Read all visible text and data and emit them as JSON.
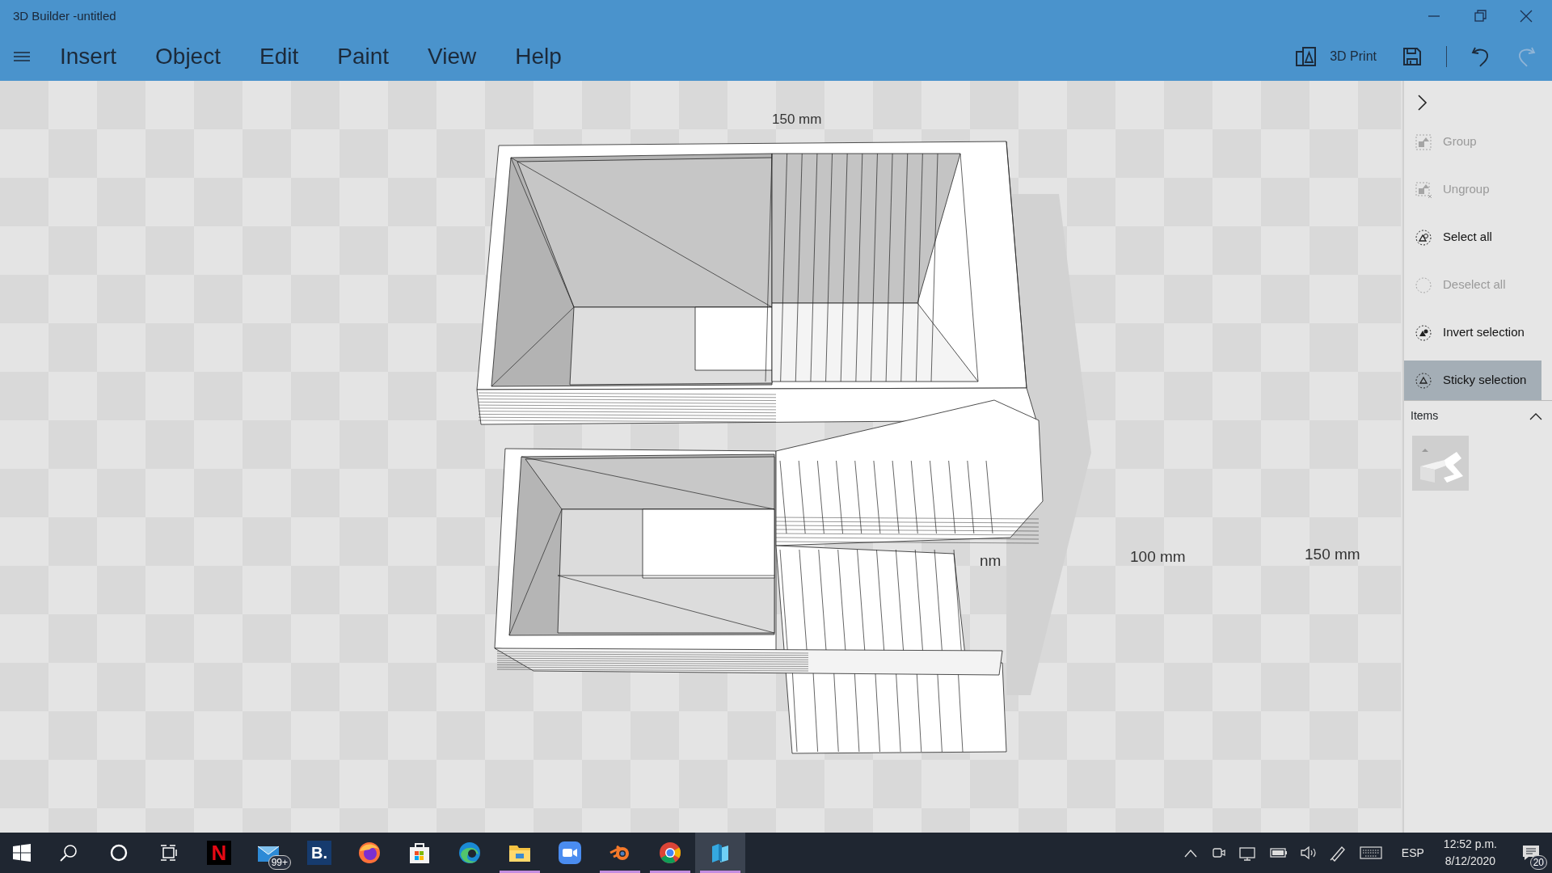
{
  "window": {
    "title": "3D Builder -untitled"
  },
  "menu": [
    {
      "label": "Insert"
    },
    {
      "label": "Object"
    },
    {
      "label": "Edit"
    },
    {
      "label": "Paint"
    },
    {
      "label": "View"
    },
    {
      "label": "Help"
    }
  ],
  "toolbar": {
    "print_label": "3D Print",
    "undo_disabled": false,
    "redo_disabled": true
  },
  "viewport": {
    "rulers": [
      {
        "text": "150 mm"
      },
      {
        "text": "nm"
      },
      {
        "text": "100 mm"
      },
      {
        "text": "150 mm"
      }
    ]
  },
  "panel": {
    "actions": [
      {
        "kind": "group",
        "label": "Group",
        "disabled": true,
        "selected": false
      },
      {
        "kind": "ungroup",
        "label": "Ungroup",
        "disabled": true,
        "selected": false
      },
      {
        "kind": "select",
        "label": "Select all",
        "disabled": false,
        "selected": false
      },
      {
        "kind": "deselect",
        "label": "Deselect all",
        "disabled": true,
        "selected": false
      },
      {
        "kind": "invert",
        "label": "Invert selection",
        "disabled": false,
        "selected": false
      },
      {
        "kind": "sticky",
        "label": "Sticky selection",
        "disabled": false,
        "selected": true
      }
    ],
    "items_header": "Items",
    "items_expanded": true
  },
  "taskbar": {
    "apps": [
      {
        "kind": "start",
        "running": false,
        "active": false
      },
      {
        "kind": "search",
        "running": false,
        "active": false
      },
      {
        "kind": "cortana",
        "running": false,
        "active": false
      },
      {
        "kind": "taskview",
        "running": false,
        "active": false
      },
      {
        "kind": "netflix",
        "label": "N",
        "running": false,
        "active": false
      },
      {
        "kind": "mail",
        "badge": "99+",
        "running": false,
        "active": false
      },
      {
        "kind": "booking",
        "label": "B.",
        "running": false,
        "active": false
      },
      {
        "kind": "firefox",
        "running": false,
        "active": false
      },
      {
        "kind": "store",
        "running": false,
        "active": false
      },
      {
        "kind": "edge",
        "running": false,
        "active": false
      },
      {
        "kind": "explorer",
        "running": true,
        "active": false
      },
      {
        "kind": "zoom",
        "running": false,
        "active": false
      },
      {
        "kind": "blender",
        "running": true,
        "active": false
      },
      {
        "kind": "chrome",
        "running": true,
        "active": false
      },
      {
        "kind": "builder",
        "running": true,
        "active": true
      }
    ],
    "language": "ESP",
    "time": "12:52 p.m.",
    "date": "8/12/2020",
    "notifications": "20"
  }
}
